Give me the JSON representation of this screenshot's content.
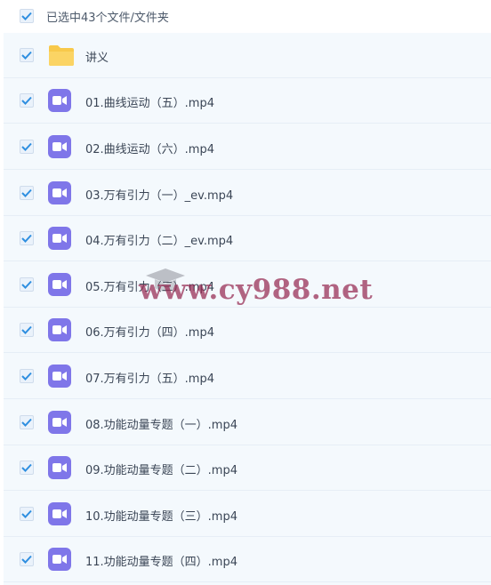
{
  "header": {
    "selection_label": "已选中43个文件/文件夹"
  },
  "files": [
    {
      "name": "讲义",
      "type": "folder"
    },
    {
      "name": "01.曲线运动（五）.mp4",
      "type": "video"
    },
    {
      "name": "02.曲线运动（六）.mp4",
      "type": "video"
    },
    {
      "name": "03.万有引力（一）_ev.mp4",
      "type": "video"
    },
    {
      "name": "04.万有引力（二）_ev.mp4",
      "type": "video"
    },
    {
      "name": "05.万有引力（三）.mp4",
      "type": "video"
    },
    {
      "name": "06.万有引力（四）.mp4",
      "type": "video"
    },
    {
      "name": "07.万有引力（五）.mp4",
      "type": "video"
    },
    {
      "name": "08.功能动量专题（一）.mp4",
      "type": "video"
    },
    {
      "name": "09.功能动量专题（二）.mp4",
      "type": "video"
    },
    {
      "name": "10.功能动量专题（三）.mp4",
      "type": "video"
    },
    {
      "name": "11.功能动量专题（四）.mp4",
      "type": "video"
    }
  ],
  "watermark": {
    "text": "www.cy988.net"
  },
  "colors": {
    "checkbox_check": "#2f8fe0",
    "video_icon": "#7f76e9",
    "folder_icon": "#f8c94a",
    "list_background": "#f4f9fd"
  }
}
